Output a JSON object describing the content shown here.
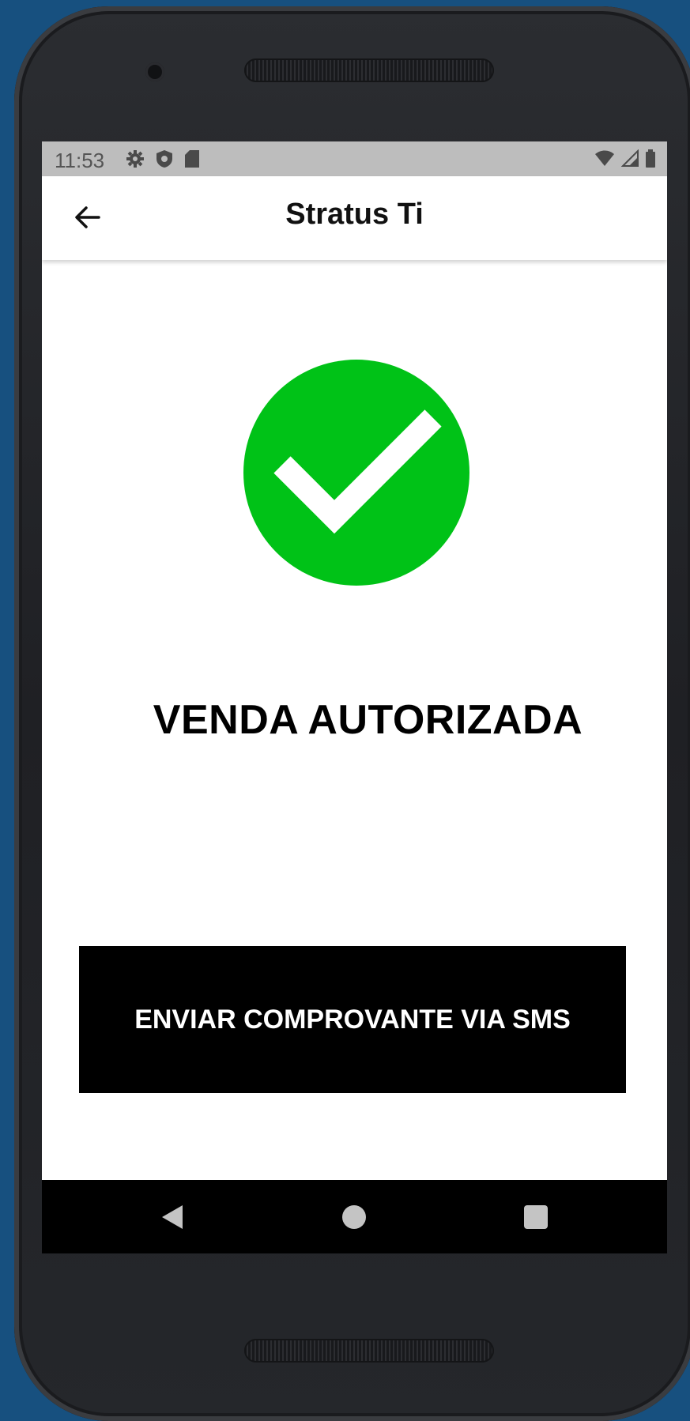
{
  "status_bar": {
    "time": "11:53",
    "left_icons": [
      "gear-icon",
      "shield-icon",
      "sd-card-icon"
    ],
    "right_icons": [
      "wifi-icon",
      "signal-icon",
      "battery-icon"
    ]
  },
  "app_bar": {
    "title": "Stratus Ti",
    "back_icon": "arrow-left-icon"
  },
  "result": {
    "icon": "check-circle-icon",
    "icon_color": "#00c217",
    "message": "VENDA AUTORIZADA"
  },
  "actions": {
    "sms_button_label": "ENVIAR COMPROVANTE VIA SMS"
  },
  "nav_bar": {
    "buttons": [
      "back-triangle-icon",
      "home-circle-icon",
      "recent-square-icon"
    ]
  },
  "colors": {
    "background": "#17507f",
    "status_bar": "#bdbdbd",
    "button": "#000000",
    "success": "#00c217"
  }
}
